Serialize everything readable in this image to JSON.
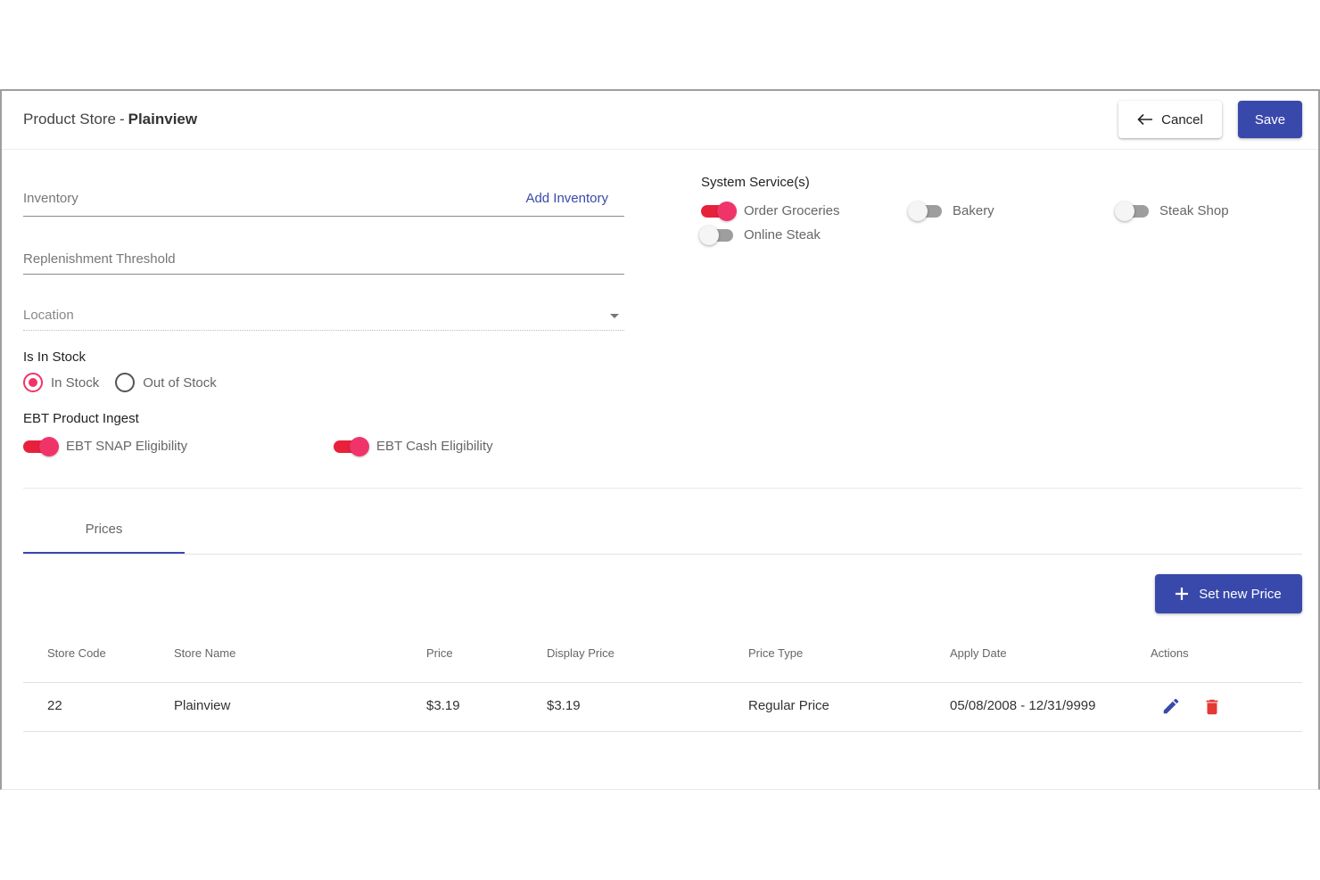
{
  "header": {
    "title_prefix": "Product Store",
    "title_sep": "-",
    "title_store": "Plainview",
    "cancel_label": "Cancel",
    "save_label": "Save"
  },
  "form": {
    "inventory_label": "Inventory",
    "add_inventory_label": "Add Inventory",
    "replenishment_label": "Replenishment Threshold",
    "location_label": "Location",
    "in_stock_section": "Is In Stock",
    "in_stock_option": "In Stock",
    "out_of_stock_option": "Out of Stock",
    "selected_stock": "In Stock",
    "ebt_section": "EBT Product Ingest",
    "ebt_snap": {
      "label": "EBT SNAP Eligibility",
      "on": true
    },
    "ebt_cash": {
      "label": "EBT Cash Eligibility",
      "on": true
    }
  },
  "services": {
    "title": "System Service(s)",
    "items": [
      {
        "label": "Order Groceries",
        "on": true
      },
      {
        "label": "Bakery",
        "on": false
      },
      {
        "label": "Steak Shop",
        "on": false
      },
      {
        "label": "Online Steak",
        "on": false
      }
    ]
  },
  "tabs": {
    "prices_label": "Prices"
  },
  "prices": {
    "set_new_price_label": "Set new Price",
    "columns": [
      "Store Code",
      "Store Name",
      "Price",
      "Display Price",
      "Price Type",
      "Apply Date",
      "Actions"
    ],
    "rows": [
      {
        "store_code": "22",
        "store_name": "Plainview",
        "price": "$3.19",
        "display_price": "$3.19",
        "price_type": "Regular Price",
        "apply_date": "05/08/2008 - 12/31/9999"
      }
    ]
  },
  "colors": {
    "primary": "#3949ab",
    "accent": "#f0346a",
    "delete": "#e53935"
  },
  "icons": [
    "arrow-left-icon",
    "plus-icon",
    "edit-pencil-icon",
    "delete-trash-icon",
    "dropdown-caret-icon"
  ]
}
